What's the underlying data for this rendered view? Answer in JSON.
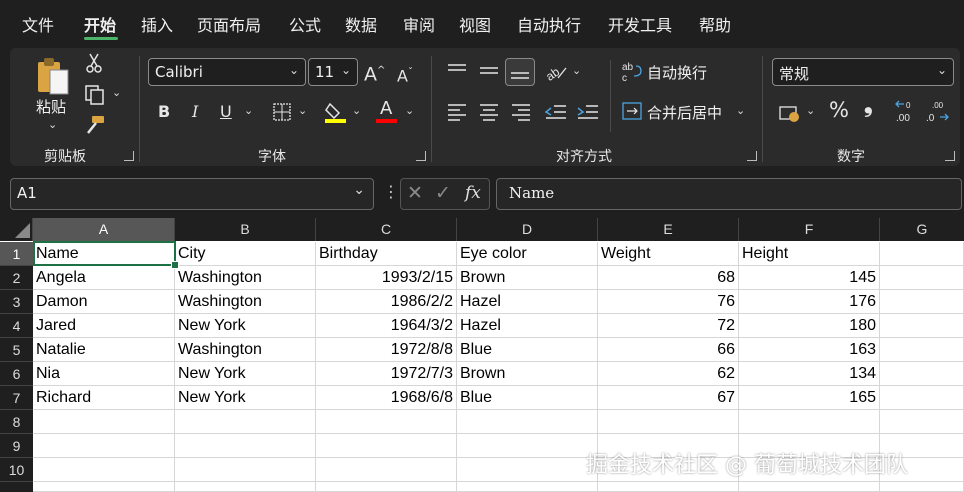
{
  "menu": {
    "items": [
      "文件",
      "开始",
      "插入",
      "页面布局",
      "公式",
      "数据",
      "审阅",
      "视图",
      "自动执行",
      "开发工具",
      "帮助"
    ],
    "active": "开始"
  },
  "ribbon": {
    "clipboard": {
      "paste_label": "粘贴",
      "group_label": "剪贴板"
    },
    "font": {
      "font_name": "Calibri",
      "font_size": "11",
      "bold": "B",
      "italic": "I",
      "underline": "U",
      "font_color_glyph": "A",
      "group_label": "字体"
    },
    "alignment": {
      "wrap_text": "自动换行",
      "merge_center": "合并后居中",
      "group_label": "对齐方式"
    },
    "number": {
      "format": "常规",
      "percent": "%",
      "comma": "❟",
      "group_label": "数字"
    }
  },
  "formula_bar": {
    "name_box": "A1",
    "fx": "fx",
    "content": "Name"
  },
  "columns": [
    "A",
    "B",
    "C",
    "D",
    "E",
    "F",
    "G"
  ],
  "rows": [
    "1",
    "2",
    "3",
    "4",
    "5",
    "6",
    "7",
    "8",
    "9",
    "10"
  ],
  "table": {
    "headers": [
      "Name",
      "City",
      "Birthday",
      "Eye color",
      "Weight",
      "Height"
    ],
    "data": [
      [
        "Angela",
        "Washington",
        "1993/2/15",
        "Brown",
        "68",
        "145"
      ],
      [
        "Damon",
        "Washington",
        "1986/2/2",
        "Hazel",
        "76",
        "176"
      ],
      [
        "Jared",
        "New York",
        "1964/3/2",
        "Hazel",
        "72",
        "180"
      ],
      [
        "Natalie",
        "Washington",
        "1972/8/8",
        "Blue",
        "66",
        "163"
      ],
      [
        "Nia",
        "New York",
        "1972/7/3",
        "Brown",
        "62",
        "134"
      ],
      [
        "Richard",
        "New York",
        "1968/6/8",
        "Blue",
        "67",
        "165"
      ]
    ]
  },
  "watermark": "掘金技术社区 @ 葡萄城技术团队",
  "colors": {
    "accent": "#4cb36a",
    "selection": "#1e7145",
    "highlight_yellow": "#ffff00",
    "font_red": "#ff0000"
  }
}
